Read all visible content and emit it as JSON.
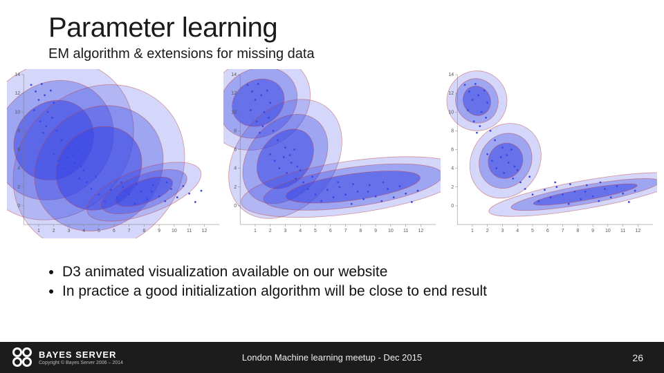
{
  "title": "Parameter learning",
  "subtitle": "EM algorithm & extensions for missing data",
  "bullets": [
    "D3 animated visualization available on our website",
    "In practice a good initialization algorithm will be close to end result"
  ],
  "footer": {
    "brand": "BAYES SERVER",
    "copyright": "Copyright © Bayes Server 2006 – 2014",
    "center": "London Machine learning meetup - Dec 2015",
    "page": "26"
  },
  "chart_data": [
    {
      "type": "scatter",
      "title": "",
      "xlabel": "",
      "ylabel": "",
      "xlim": [
        0,
        13
      ],
      "ylim": [
        -2,
        14
      ],
      "x_ticks": [
        1,
        2,
        3,
        4,
        5,
        6,
        7,
        8,
        9,
        10,
        11,
        12
      ],
      "y_ticks": [
        0,
        2,
        4,
        6,
        8,
        10,
        12,
        14
      ],
      "ellipses": [
        {
          "cx": 2.0,
          "cy": 7.0,
          "rx_levels": [
            2.8,
            4.2,
            5.6
          ],
          "ry_levels": [
            4.0,
            6.0,
            8.0
          ],
          "angle": -45
        },
        {
          "cx": 5.0,
          "cy": 4.0,
          "rx_levels": [
            3.0,
            4.5,
            6.0
          ],
          "ry_levels": [
            4.2,
            6.3,
            8.4
          ],
          "angle": -40
        },
        {
          "cx": 8.0,
          "cy": 1.5,
          "rx_levels": [
            2.0,
            3.0,
            4.0
          ],
          "ry_levels": [
            1.2,
            1.8,
            2.4
          ],
          "angle": -20
        }
      ],
      "points": [
        [
          0.5,
          12.9
        ],
        [
          0.8,
          12.2
        ],
        [
          1.0,
          11.3
        ],
        [
          1.2,
          13.0
        ],
        [
          1.4,
          11.8
        ],
        [
          1.6,
          10.0
        ],
        [
          1.8,
          12.3
        ],
        [
          2.0,
          11.0
        ],
        [
          0.7,
          10.2
        ],
        [
          1.1,
          9.0
        ],
        [
          1.5,
          8.5
        ],
        [
          1.9,
          9.4
        ],
        [
          2.2,
          8.0
        ],
        [
          2.5,
          7.0
        ],
        [
          1.3,
          7.8
        ],
        [
          2.0,
          5.5
        ],
        [
          2.3,
          4.8
        ],
        [
          2.6,
          4.0
        ],
        [
          2.9,
          5.2
        ],
        [
          3.1,
          3.5
        ],
        [
          3.4,
          4.6
        ],
        [
          3.7,
          2.9
        ],
        [
          4.0,
          3.8
        ],
        [
          4.2,
          2.5
        ],
        [
          4.5,
          1.8
        ],
        [
          4.8,
          3.1
        ],
        [
          3.0,
          6.2
        ],
        [
          3.3,
          5.4
        ],
        [
          3.6,
          6.0
        ],
        [
          3.8,
          4.2
        ],
        [
          5.0,
          1.2
        ],
        [
          5.4,
          0.5
        ],
        [
          5.8,
          1.7
        ],
        [
          6.2,
          0.9
        ],
        [
          6.6,
          2.0
        ],
        [
          7.0,
          1.2
        ],
        [
          7.4,
          0.2
        ],
        [
          7.8,
          1.5
        ],
        [
          8.2,
          0.7
        ],
        [
          8.6,
          2.2
        ],
        [
          9.0,
          1.0
        ],
        [
          9.4,
          0.5
        ],
        [
          9.8,
          1.8
        ],
        [
          10.2,
          0.9
        ],
        [
          10.6,
          2.1
        ],
        [
          11.0,
          1.3
        ],
        [
          11.4,
          0.4
        ],
        [
          11.8,
          1.6
        ],
        [
          6.5,
          2.5
        ],
        [
          7.5,
          2.3
        ],
        [
          8.5,
          1.5
        ],
        [
          9.5,
          2.5
        ]
      ]
    },
    {
      "type": "scatter",
      "title": "",
      "xlabel": "",
      "ylabel": "",
      "xlim": [
        0,
        13
      ],
      "ylim": [
        -2,
        14
      ],
      "x_ticks": [
        1,
        2,
        3,
        4,
        5,
        6,
        7,
        8,
        9,
        10,
        11,
        12
      ],
      "y_ticks": [
        0,
        2,
        4,
        6,
        8,
        10,
        12,
        14
      ],
      "ellipses": [
        {
          "cx": 1.2,
          "cy": 11.0,
          "rx_levels": [
            1.8,
            2.7,
            3.6
          ],
          "ry_levels": [
            2.4,
            3.6,
            4.8
          ],
          "angle": -30
        },
        {
          "cx": 3.0,
          "cy": 5.0,
          "rx_levels": [
            2.2,
            3.3,
            4.4
          ],
          "ry_levels": [
            2.6,
            3.9,
            5.2
          ],
          "angle": -50
        },
        {
          "cx": 7.5,
          "cy": 2.0,
          "rx_levels": [
            4.5,
            6.0,
            7.5
          ],
          "ry_levels": [
            1.4,
            2.1,
            2.8
          ],
          "angle": -8
        }
      ],
      "points": [
        [
          0.5,
          12.9
        ],
        [
          0.8,
          12.2
        ],
        [
          1.0,
          11.3
        ],
        [
          1.2,
          13.0
        ],
        [
          1.4,
          11.8
        ],
        [
          1.6,
          10.0
        ],
        [
          1.8,
          12.3
        ],
        [
          2.0,
          11.0
        ],
        [
          0.7,
          10.2
        ],
        [
          1.1,
          9.0
        ],
        [
          1.5,
          8.5
        ],
        [
          1.9,
          9.4
        ],
        [
          2.2,
          8.0
        ],
        [
          2.5,
          7.0
        ],
        [
          1.3,
          7.8
        ],
        [
          2.0,
          5.5
        ],
        [
          2.3,
          4.8
        ],
        [
          2.6,
          4.0
        ],
        [
          2.9,
          5.2
        ],
        [
          3.1,
          3.5
        ],
        [
          3.4,
          4.6
        ],
        [
          3.7,
          2.9
        ],
        [
          4.0,
          3.8
        ],
        [
          4.2,
          2.5
        ],
        [
          4.5,
          1.8
        ],
        [
          4.8,
          3.1
        ],
        [
          3.0,
          6.2
        ],
        [
          3.3,
          5.4
        ],
        [
          3.6,
          6.0
        ],
        [
          3.8,
          4.2
        ],
        [
          5.0,
          1.2
        ],
        [
          5.4,
          0.5
        ],
        [
          5.8,
          1.7
        ],
        [
          6.2,
          0.9
        ],
        [
          6.6,
          2.0
        ],
        [
          7.0,
          1.2
        ],
        [
          7.4,
          0.2
        ],
        [
          7.8,
          1.5
        ],
        [
          8.2,
          0.7
        ],
        [
          8.6,
          2.2
        ],
        [
          9.0,
          1.0
        ],
        [
          9.4,
          0.5
        ],
        [
          9.8,
          1.8
        ],
        [
          10.2,
          0.9
        ],
        [
          10.6,
          2.1
        ],
        [
          11.0,
          1.3
        ],
        [
          11.4,
          0.4
        ],
        [
          11.8,
          1.6
        ],
        [
          6.5,
          2.5
        ],
        [
          7.5,
          2.3
        ],
        [
          8.5,
          1.5
        ],
        [
          9.5,
          2.5
        ]
      ]
    },
    {
      "type": "scatter",
      "title": "",
      "xlabel": "",
      "ylabel": "",
      "xlim": [
        0,
        13
      ],
      "ylim": [
        -2,
        14
      ],
      "x_ticks": [
        1,
        2,
        3,
        4,
        5,
        6,
        7,
        8,
        9,
        10,
        11,
        12
      ],
      "y_ticks": [
        0,
        2,
        4,
        6,
        8,
        10,
        12,
        14
      ],
      "ellipses": [
        {
          "cx": 1.3,
          "cy": 11.2,
          "rx_levels": [
            0.9,
            1.4,
            2.0
          ],
          "ry_levels": [
            1.6,
            2.4,
            3.2
          ],
          "angle": -25
        },
        {
          "cx": 3.2,
          "cy": 4.8,
          "rx_levels": [
            1.2,
            1.9,
            2.6
          ],
          "ry_levels": [
            1.8,
            2.7,
            3.6
          ],
          "angle": -55
        },
        {
          "cx": 8.5,
          "cy": 1.2,
          "rx_levels": [
            3.5,
            5.0,
            6.5
          ],
          "ry_levels": [
            0.6,
            1.0,
            1.5
          ],
          "angle": -10
        }
      ],
      "points": [
        [
          0.5,
          12.9
        ],
        [
          0.8,
          12.2
        ],
        [
          1.0,
          11.3
        ],
        [
          1.2,
          13.0
        ],
        [
          1.4,
          11.8
        ],
        [
          1.6,
          10.0
        ],
        [
          1.8,
          12.3
        ],
        [
          2.0,
          11.0
        ],
        [
          0.7,
          10.2
        ],
        [
          1.1,
          9.0
        ],
        [
          1.5,
          8.5
        ],
        [
          1.9,
          9.4
        ],
        [
          2.2,
          8.0
        ],
        [
          2.5,
          7.0
        ],
        [
          1.3,
          7.8
        ],
        [
          2.0,
          5.5
        ],
        [
          2.3,
          4.8
        ],
        [
          2.6,
          4.0
        ],
        [
          2.9,
          5.2
        ],
        [
          3.1,
          3.5
        ],
        [
          3.4,
          4.6
        ],
        [
          3.7,
          2.9
        ],
        [
          4.0,
          3.8
        ],
        [
          4.2,
          2.5
        ],
        [
          4.5,
          1.8
        ],
        [
          4.8,
          3.1
        ],
        [
          3.0,
          6.2
        ],
        [
          3.3,
          5.4
        ],
        [
          3.6,
          6.0
        ],
        [
          3.8,
          4.2
        ],
        [
          5.0,
          1.2
        ],
        [
          5.4,
          0.5
        ],
        [
          5.8,
          1.7
        ],
        [
          6.2,
          0.9
        ],
        [
          6.6,
          2.0
        ],
        [
          7.0,
          1.2
        ],
        [
          7.4,
          0.2
        ],
        [
          7.8,
          1.5
        ],
        [
          8.2,
          0.7
        ],
        [
          8.6,
          2.2
        ],
        [
          9.0,
          1.0
        ],
        [
          9.4,
          0.5
        ],
        [
          9.8,
          1.8
        ],
        [
          10.2,
          0.9
        ],
        [
          10.6,
          2.1
        ],
        [
          11.0,
          1.3
        ],
        [
          11.4,
          0.4
        ],
        [
          11.8,
          1.6
        ],
        [
          6.5,
          2.5
        ],
        [
          7.5,
          2.3
        ],
        [
          8.5,
          1.5
        ],
        [
          9.5,
          2.5
        ]
      ]
    }
  ]
}
